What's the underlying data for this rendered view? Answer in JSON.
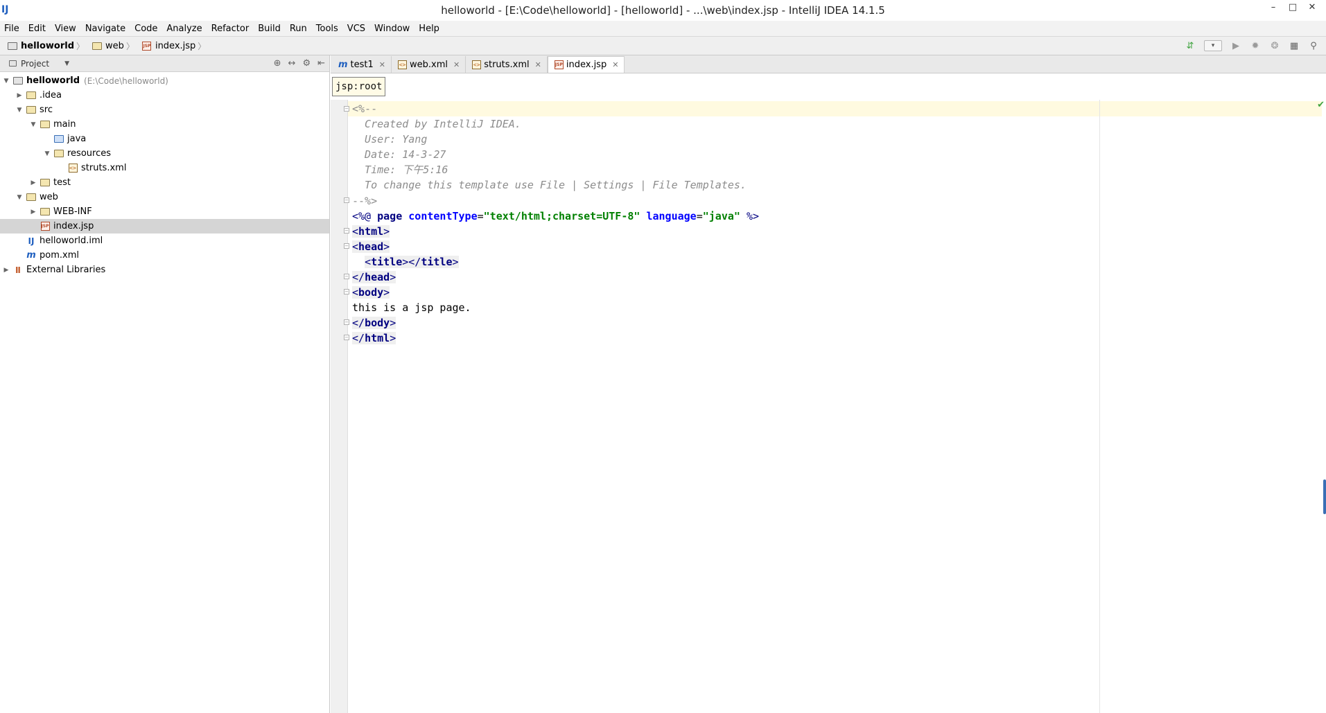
{
  "window": {
    "title": "helloworld - [E:\\Code\\helloworld] - [helloworld] - ...\\web\\index.jsp - IntelliJ IDEA 14.1.5",
    "app_icon": "IJ",
    "minimize": "–",
    "maximize": "□",
    "close": "✕"
  },
  "menu": [
    "File",
    "Edit",
    "View",
    "Navigate",
    "Code",
    "Analyze",
    "Refactor",
    "Build",
    "Run",
    "Tools",
    "VCS",
    "Window",
    "Help"
  ],
  "navbar": {
    "crumbs": [
      {
        "label": "helloworld",
        "icon": "module-folder-icon"
      },
      {
        "label": "web",
        "icon": "web-folder-icon"
      },
      {
        "label": "index.jsp",
        "icon": "jsp-file-icon"
      }
    ]
  },
  "project_panel": {
    "header": "Project",
    "tree": [
      {
        "label": "helloworld",
        "hint": "(E:\\Code\\helloworld)",
        "level": 0,
        "toggle": "▼",
        "icon": "module-folder-icon",
        "bold": true
      },
      {
        "label": ".idea",
        "level": 1,
        "toggle": "▶",
        "icon": "folder-icon"
      },
      {
        "label": "src",
        "level": 1,
        "toggle": "▼",
        "icon": "folder-icon"
      },
      {
        "label": "main",
        "level": 2,
        "toggle": "▼",
        "icon": "folder-icon"
      },
      {
        "label": "java",
        "level": 3,
        "toggle": "",
        "icon": "source-folder-icon"
      },
      {
        "label": "resources",
        "level": 3,
        "toggle": "▼",
        "icon": "resources-folder-icon"
      },
      {
        "label": "struts.xml",
        "level": 4,
        "toggle": "",
        "icon": "xml-file-icon"
      },
      {
        "label": "test",
        "level": 2,
        "toggle": "▶",
        "icon": "folder-icon"
      },
      {
        "label": "web",
        "level": 1,
        "toggle": "▼",
        "icon": "web-folder-icon"
      },
      {
        "label": "WEB-INF",
        "level": 2,
        "toggle": "▶",
        "icon": "folder-icon"
      },
      {
        "label": "index.jsp",
        "level": 2,
        "toggle": "",
        "icon": "jsp-file-icon",
        "selected": true
      },
      {
        "label": "helloworld.iml",
        "level": 1,
        "toggle": "",
        "icon": "iml-file-icon"
      },
      {
        "label": "pom.xml",
        "level": 1,
        "toggle": "",
        "icon": "maven-file-icon"
      },
      {
        "label": "External Libraries",
        "level": 0,
        "toggle": "▶",
        "icon": "libraries-icon"
      }
    ]
  },
  "editor": {
    "tabs": [
      {
        "label": "test1",
        "icon": "maven-file-icon",
        "active": false
      },
      {
        "label": "web.xml",
        "icon": "xml-file-icon",
        "active": false
      },
      {
        "label": "struts.xml",
        "icon": "xml-file-icon",
        "active": false
      },
      {
        "label": "index.jsp",
        "icon": "jsp-file-icon",
        "active": true
      }
    ],
    "breadcrumb": "jsp:root",
    "code": {
      "comment_open": "<%--",
      "comment_lines": [
        "  Created by IntelliJ IDEA.",
        "  User: Yang",
        "  Date: 14-3-27",
        "  Time: 下午5:16",
        "  To change this template use File | Settings | File Templates."
      ],
      "comment_close": "--%>",
      "directive": {
        "open": "<%@ ",
        "keyword": "page",
        "attr1": "contentType",
        "val1": "\"text/html;charset=UTF-8\"",
        "attr2": "language",
        "val2": "\"java\"",
        "close": " %>"
      },
      "html_tag": "html",
      "head_tag": "head",
      "title_tag": "title",
      "body_tag": "body",
      "body_text": "this is a jsp page."
    }
  }
}
